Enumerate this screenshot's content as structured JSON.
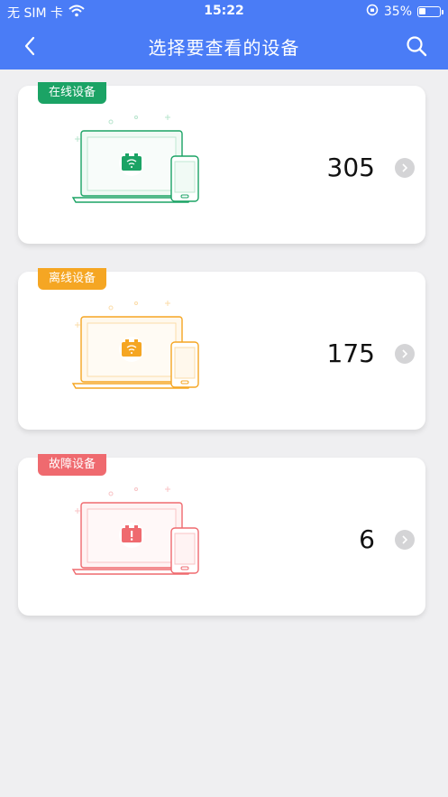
{
  "status_bar": {
    "carrier": "无 SIM 卡",
    "time": "15:22",
    "battery_percent": "35%",
    "battery_level": 0.35
  },
  "nav": {
    "title": "选择要查看的设备",
    "back_icon": "chevron-left-icon",
    "search_icon": "search-icon"
  },
  "colors": {
    "nav_bg": "#4a7cf6",
    "online": "#1ba365",
    "offline": "#f5a623",
    "fault": "#ef6a6f",
    "page_bg": "#efeff1"
  },
  "cards": [
    {
      "label": "在线设备",
      "count": "305",
      "status": "online",
      "icon": "wifi-device-icon"
    },
    {
      "label": "离线设备",
      "count": "175",
      "status": "offline",
      "icon": "wifi-device-icon"
    },
    {
      "label": "故障设备",
      "count": "6",
      "status": "fault",
      "icon": "alert-device-icon"
    }
  ]
}
